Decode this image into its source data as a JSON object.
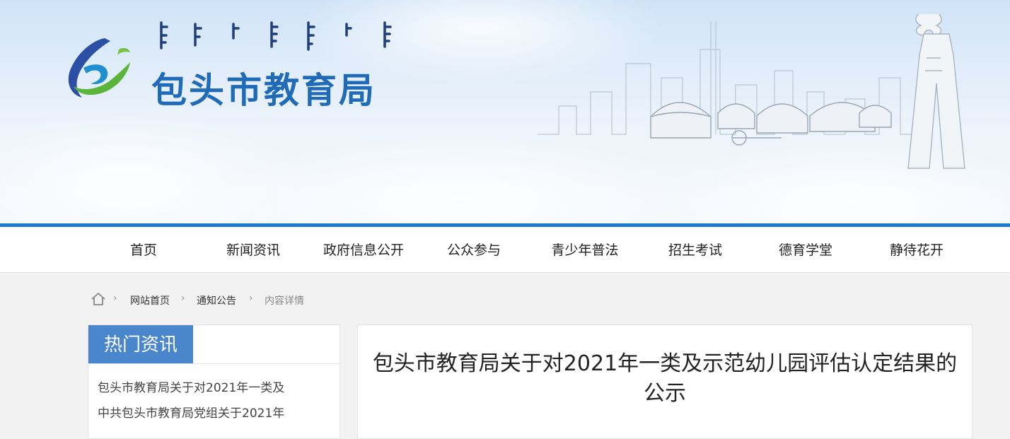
{
  "header": {
    "site_title": "包头市教育局",
    "colors": {
      "title_blue": "#1f6bb8",
      "accent_bar": "#1e78d0",
      "logo_green": "#5bb53b"
    }
  },
  "nav": {
    "items": [
      {
        "label": "首页"
      },
      {
        "label": "新闻资讯"
      },
      {
        "label": "政府信息公开"
      },
      {
        "label": "公众参与"
      },
      {
        "label": "青少年普法"
      },
      {
        "label": "招生考试"
      },
      {
        "label": "德育学堂"
      },
      {
        "label": "静待花开"
      }
    ]
  },
  "breadcrumb": {
    "icon": "home-icon",
    "items": [
      {
        "label": "网站首页"
      },
      {
        "label": "通知公告"
      },
      {
        "label": "内容详情"
      }
    ]
  },
  "sidebar": {
    "heading": "热门资讯",
    "items": [
      {
        "label": "包头市教育局关于对2021年一类及"
      },
      {
        "label": "中共包头市教育局党组关于2021年"
      }
    ]
  },
  "article": {
    "title": "包头市教育局关于对2021年一类及示范幼儿园评估认定结果的公示"
  }
}
